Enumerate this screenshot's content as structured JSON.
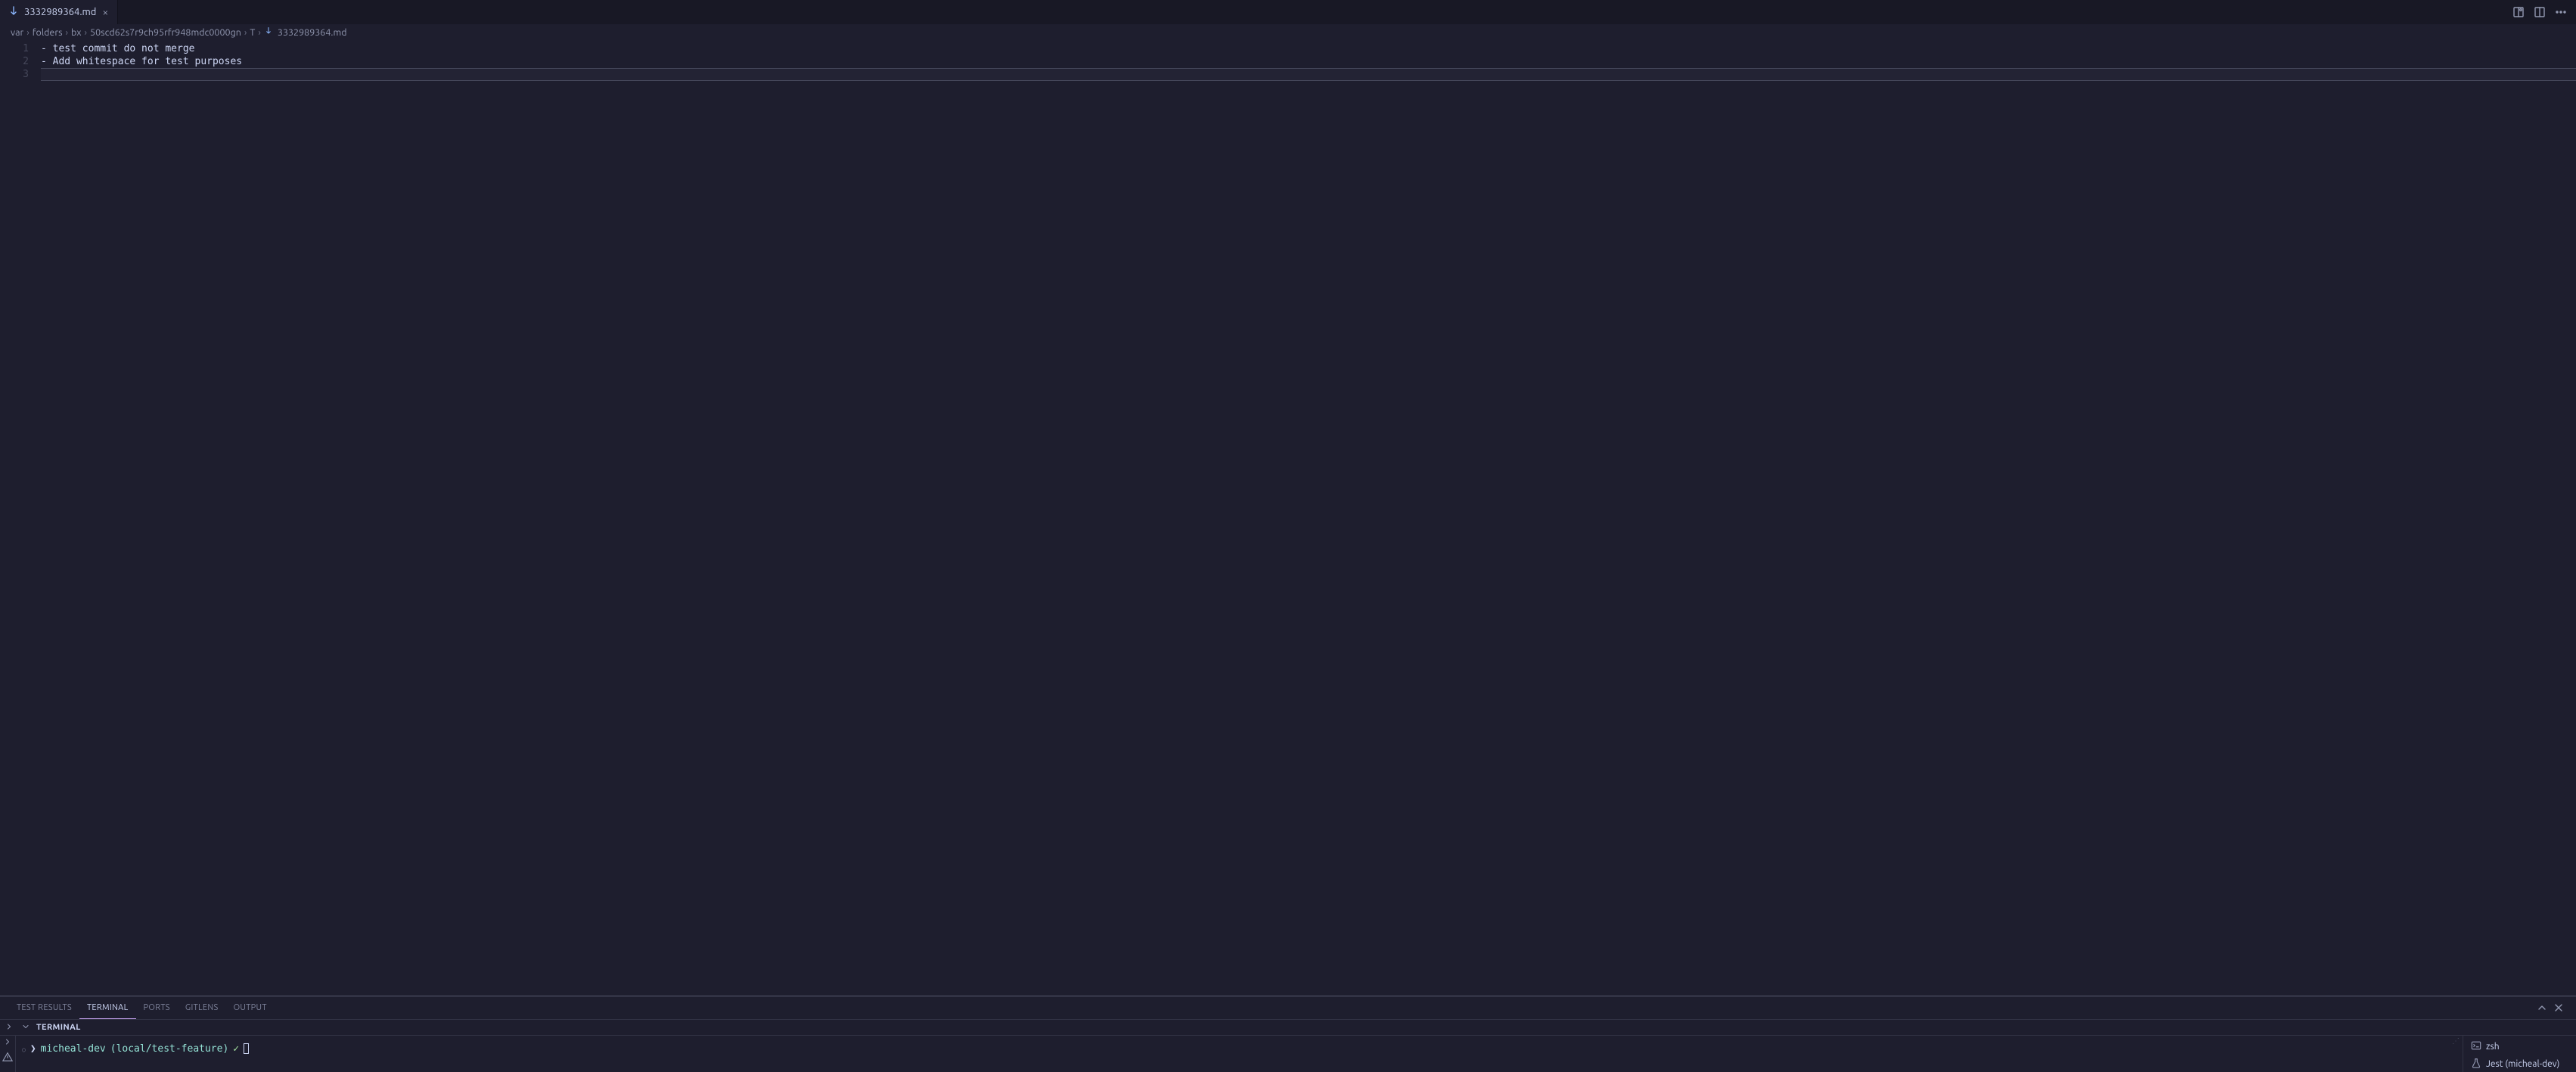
{
  "tab": {
    "filename": "3332989364.md"
  },
  "breadcrumbs": {
    "segments": [
      "var",
      "folders",
      "bx",
      "50scd62s7r9ch95rfr948mdc0000gn",
      "T",
      "3332989364.md"
    ]
  },
  "editor": {
    "lines": [
      "- test commit do not merge",
      "- Add whitespace for test purposes",
      ""
    ],
    "cursor_line_index": 2
  },
  "panel": {
    "tabs": [
      "TEST RESULTS",
      "TERMINAL",
      "PORTS",
      "GITLENS",
      "OUTPUT"
    ],
    "active_tab_index": 1,
    "header": "TERMINAL"
  },
  "terminal": {
    "prompt_symbol": "❯",
    "host": "micheal-dev",
    "branch": "(local/test-feature)",
    "check": "✓",
    "sessions": [
      {
        "name": "zsh",
        "icon": "terminal"
      },
      {
        "name": "Jest (micheal-dev)",
        "icon": "beaker"
      }
    ]
  }
}
